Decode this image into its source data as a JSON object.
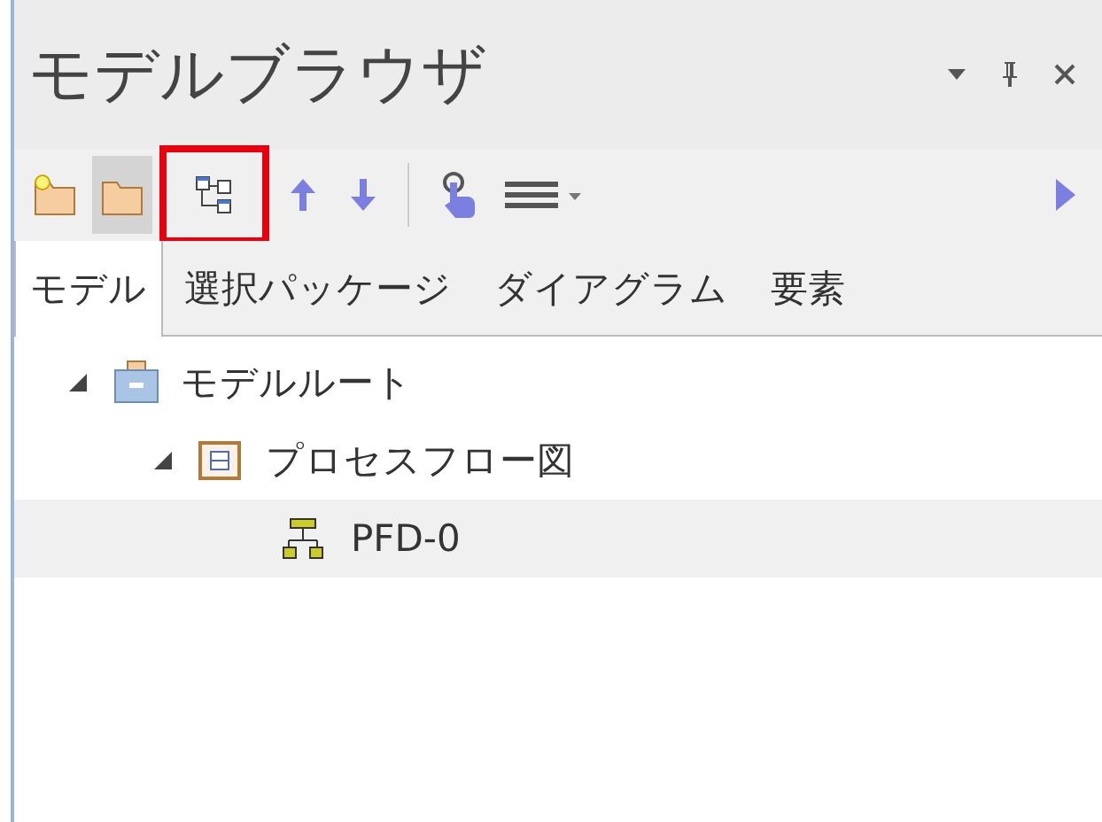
{
  "panel": {
    "title": "モデルブラウザ"
  },
  "toolbar": [
    {
      "kind": "new-package",
      "pressed": false,
      "highlighted": false
    },
    {
      "kind": "folder",
      "pressed": true,
      "highlighted": false
    },
    {
      "kind": "hierarchy",
      "pressed": false,
      "highlighted": true
    },
    {
      "kind": "up",
      "pressed": false,
      "highlighted": false
    },
    {
      "kind": "down",
      "pressed": false,
      "highlighted": false
    },
    {
      "kind": "separator"
    },
    {
      "kind": "touch",
      "pressed": false,
      "highlighted": false
    },
    {
      "kind": "menu",
      "pressed": false,
      "highlighted": false
    },
    {
      "kind": "more",
      "pressed": false,
      "highlighted": false
    }
  ],
  "tabs": [
    {
      "label": "モデル",
      "selected": true
    },
    {
      "label": "選択パッケージ",
      "selected": false
    },
    {
      "label": "ダイアグラム",
      "selected": false
    },
    {
      "label": "要素",
      "selected": false
    }
  ],
  "tree": [
    {
      "label": "モデルルート",
      "kind": "root",
      "expanded": true,
      "selected": false,
      "children": [
        {
          "label": "プロセスフロー図",
          "kind": "package",
          "expanded": true,
          "selected": false,
          "children": [
            {
              "label": "PFD-0",
              "kind": "diagram",
              "selected": false,
              "highlighted": true
            }
          ]
        }
      ]
    }
  ]
}
